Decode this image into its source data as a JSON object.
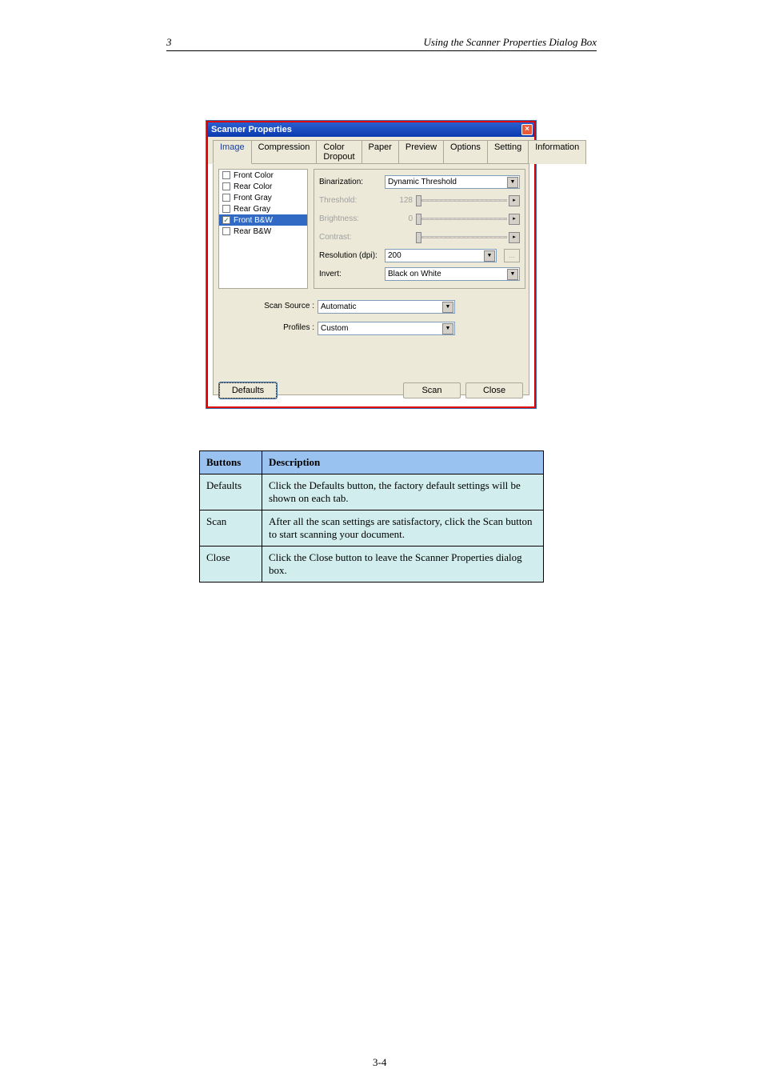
{
  "header": {
    "left": "3",
    "right": "Using the Scanner Properties Dialog Box"
  },
  "page_number": "3-4",
  "dialog": {
    "title": "Scanner Properties",
    "tabs": [
      "Image",
      "Compression",
      "Color Dropout",
      "Paper",
      "Preview",
      "Options",
      "Setting",
      "Information"
    ],
    "checklist": [
      {
        "label": "Front Color",
        "checked": false,
        "sel": false
      },
      {
        "label": "Rear Color",
        "checked": false,
        "sel": false
      },
      {
        "label": "Front Gray",
        "checked": false,
        "sel": false
      },
      {
        "label": "Rear Gray",
        "checked": false,
        "sel": false
      },
      {
        "label": "Front B&W",
        "checked": true,
        "sel": true
      },
      {
        "label": "Rear B&W",
        "checked": false,
        "sel": false
      }
    ],
    "binarization": {
      "label": "Binarization:",
      "value": "Dynamic Threshold"
    },
    "threshold": {
      "label": "Threshold:",
      "value": "128"
    },
    "brightness": {
      "label": "Brightness:",
      "value": "0"
    },
    "contrast": {
      "label": "Contrast:",
      "value": ""
    },
    "resolution": {
      "label": "Resolution (dpi):",
      "value": "200",
      "ellipsis": "..."
    },
    "invert": {
      "label": "Invert:",
      "value": "Black on White"
    },
    "scan_source": {
      "label": "Scan Source :",
      "value": "Automatic"
    },
    "profiles": {
      "label": "Profiles :",
      "value": "Custom"
    },
    "buttons": {
      "defaults": "Defaults",
      "scan": "Scan",
      "close": "Close"
    }
  },
  "table": {
    "headers": [
      "Buttons",
      "Description"
    ],
    "rows": [
      {
        "c1": "Defaults",
        "c2": "Click the Defaults button, the factory default settings will be shown on each tab."
      },
      {
        "c1": "Scan",
        "c2": "After all the scan settings are satisfactory, click the Scan button to start scanning your document."
      },
      {
        "c1": "Close",
        "c2": "Click the Close button to leave the Scanner Properties dialog box."
      }
    ]
  }
}
